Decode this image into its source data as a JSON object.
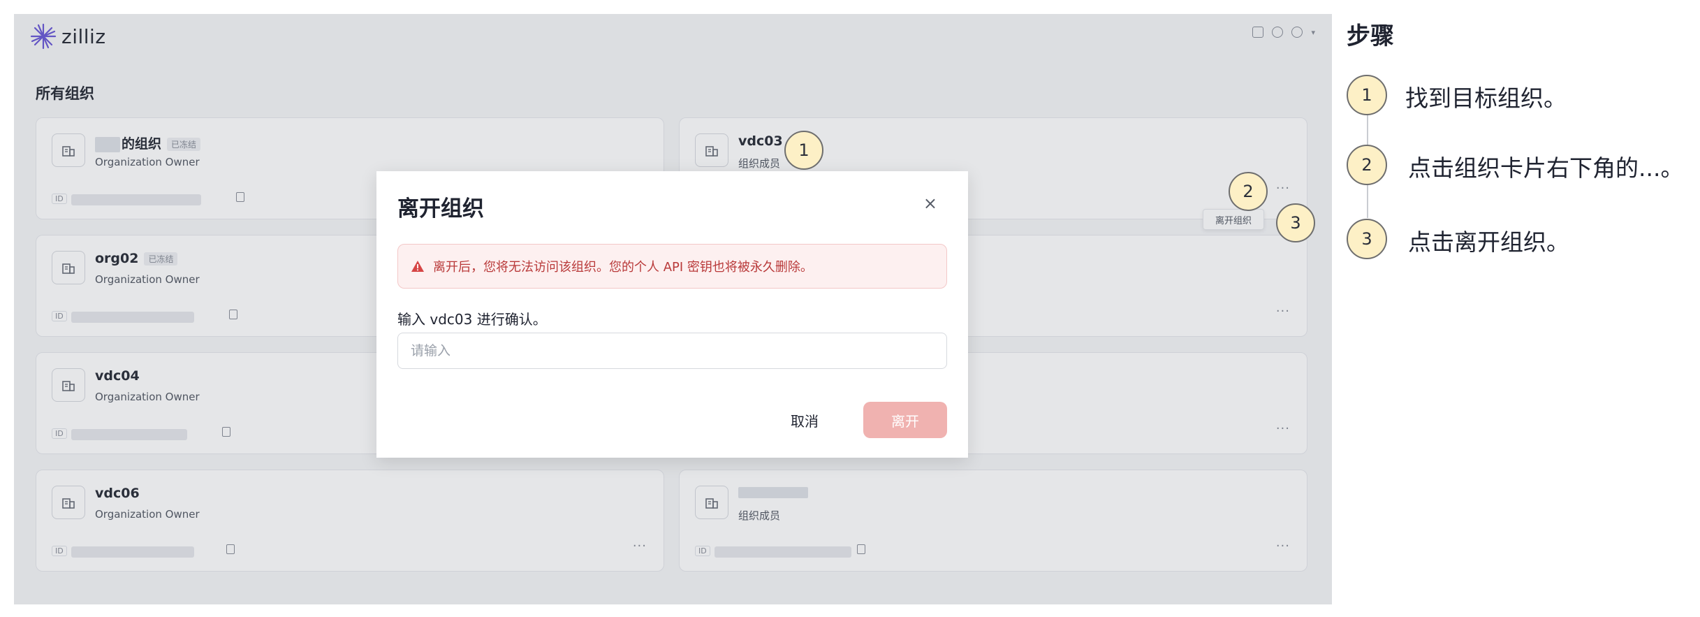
{
  "app": {
    "logo_text": "zilliz"
  },
  "page": {
    "section_title": "所有组织"
  },
  "cards": [
    {
      "name": "的组织",
      "badge": "已冻结",
      "role": "Organization Owner"
    },
    {
      "name": "vdc03",
      "role": "组织成员"
    },
    {
      "name": "org02",
      "badge": "已冻结",
      "role": "Organization Owner"
    },
    {
      "name": "vdc04",
      "role": "Organization Owner"
    },
    {
      "name": "vdc06",
      "role": "Organization Owner"
    },
    {
      "name": "",
      "role": "组织成员"
    }
  ],
  "id_label": "ID",
  "more_label": "···",
  "tooltip": {
    "leave_org": "离开组织"
  },
  "modal": {
    "title": "离开组织",
    "close": "×",
    "alert_text": "离开后，您将无法访问该组织。您的个人 API 密钥也将被永久删除。",
    "confirm_label": "输入 vdc03 进行确认。",
    "input_placeholder": "请输入",
    "cancel_label": "取消",
    "leave_label": "离开"
  },
  "markers": [
    "1",
    "2",
    "3"
  ],
  "steps": {
    "title": "步骤",
    "items": [
      {
        "num": "1",
        "text": "找到目标组织。"
      },
      {
        "num": "2",
        "text": "点击组织卡片右下角的...。"
      },
      {
        "num": "3",
        "text": "点击离开组织。"
      }
    ]
  },
  "colors": {
    "marker_fill": "#fdf0c6",
    "danger": "#b93a3a",
    "danger_button": "#f0b2b0"
  }
}
